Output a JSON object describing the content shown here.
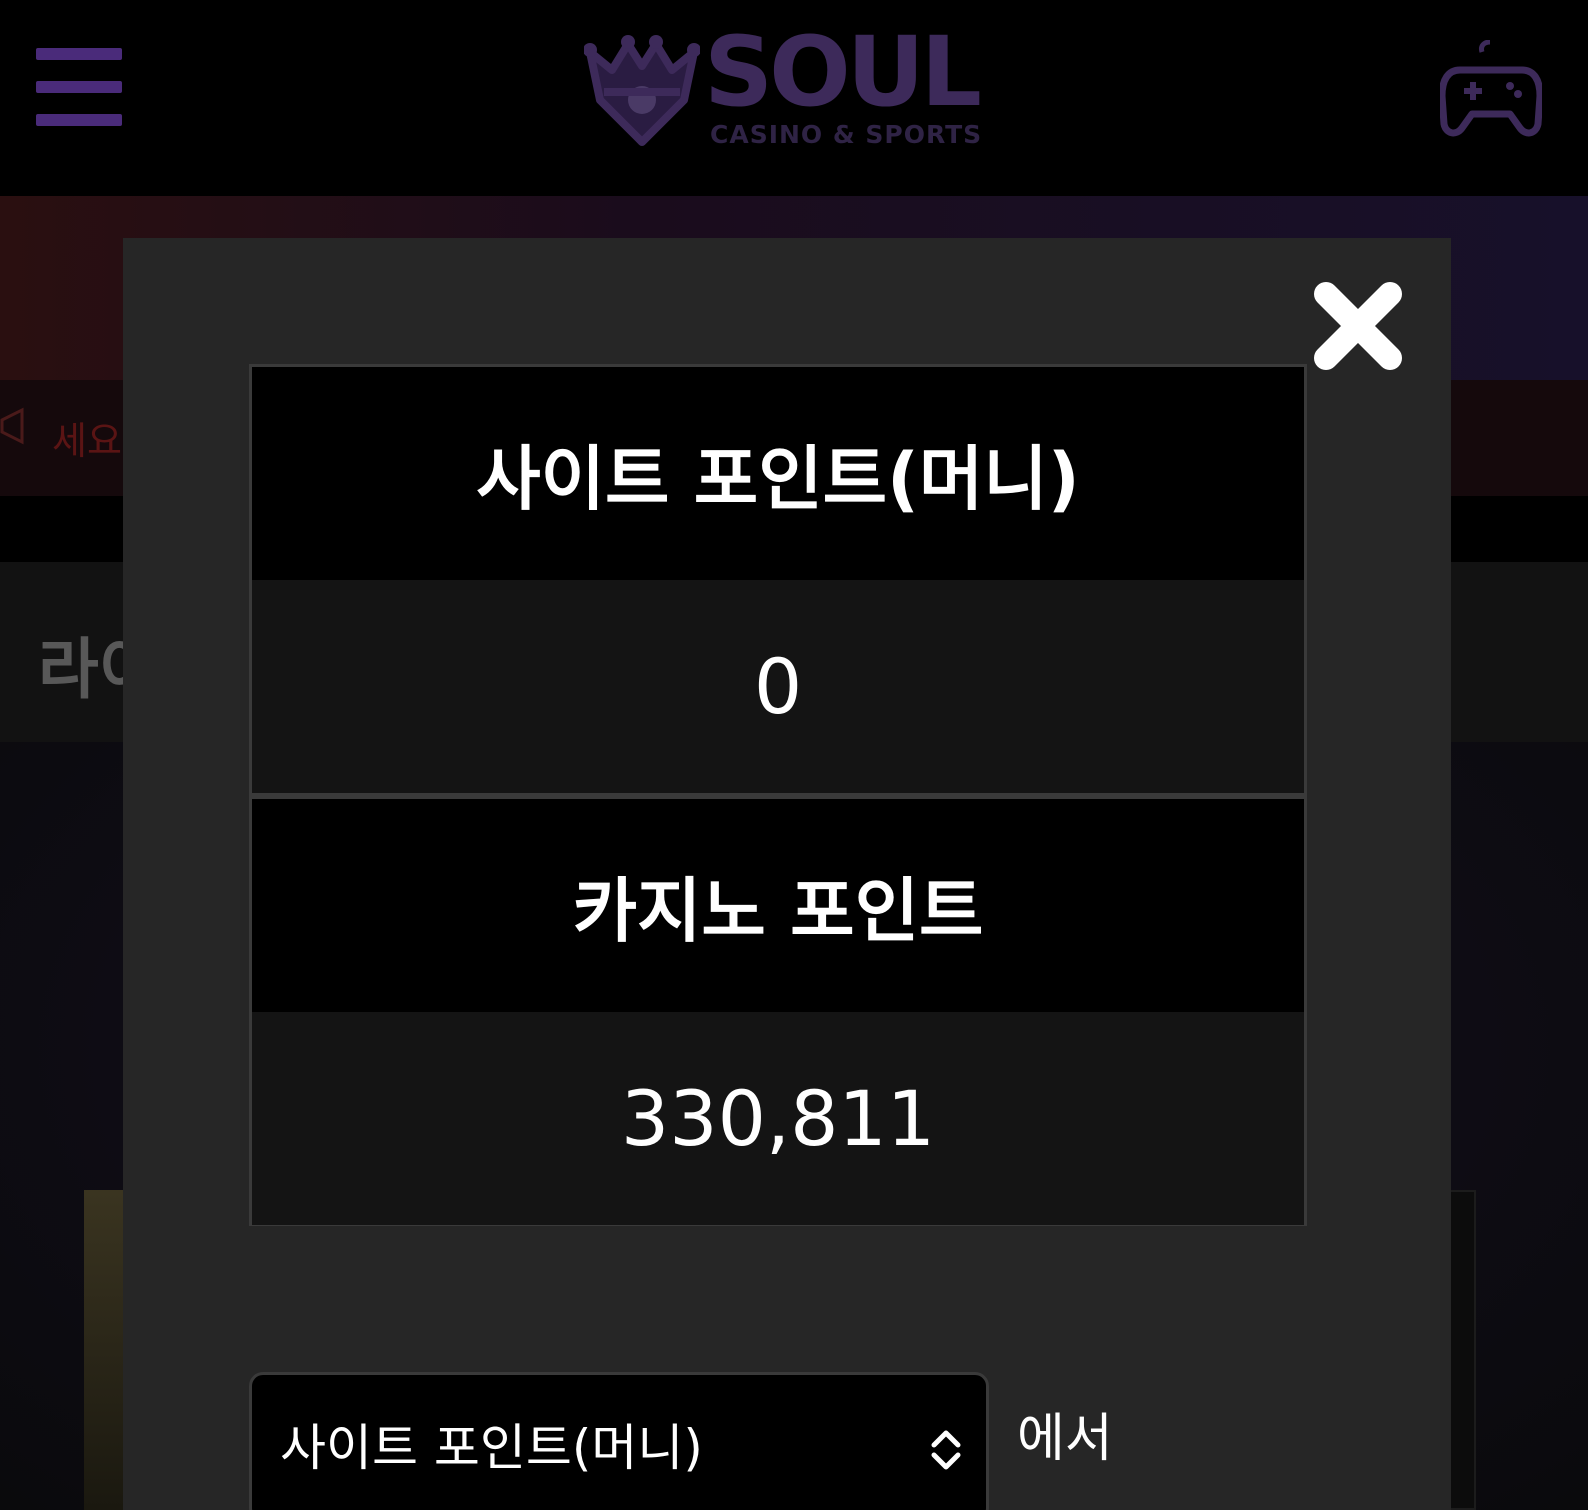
{
  "header": {
    "logo_word": "SOUL",
    "logo_sub": "CASINO & SPORTS"
  },
  "background": {
    "notice_text": "세요",
    "section_title": "라이"
  },
  "modal": {
    "site_points_label": "사이트 포인트(머니)",
    "site_points_value": "0",
    "casino_points_label": "카지노 포인트",
    "casino_points_value": "330,811",
    "source_select_value": "사이트 포인트(머니)",
    "from_suffix": "에서"
  },
  "colors": {
    "brand_purple": "#4a2b7a",
    "modal_bg": "#262626",
    "value_row_bg": "#141414"
  },
  "icons": [
    "hamburger-icon",
    "gamepad-icon",
    "close-icon",
    "select-updown-icon",
    "megaphone-icon"
  ]
}
